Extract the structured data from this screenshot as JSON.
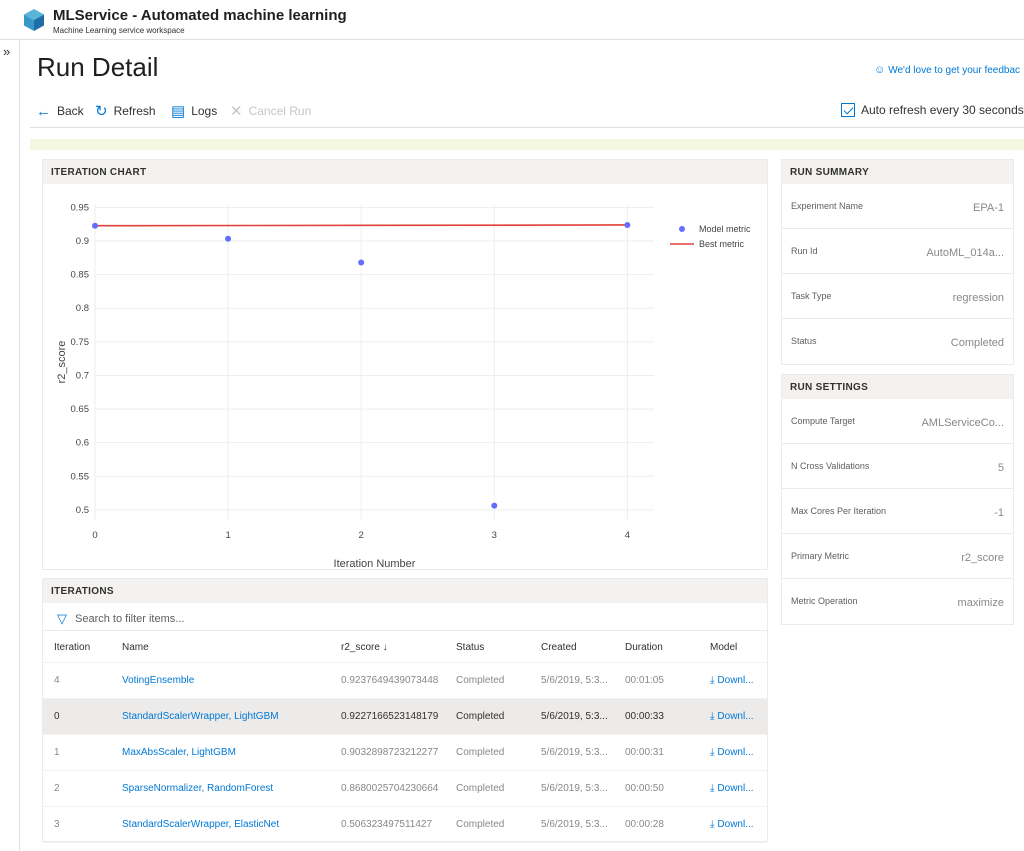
{
  "app": {
    "title": "MLService - Automated machine learning",
    "subtitle": "Machine Learning service workspace"
  },
  "nav": {
    "expand_glyph": "»"
  },
  "page": {
    "title": "Run Detail",
    "feedback": "We'd love to get your feedbac"
  },
  "toolbar": {
    "back": "Back",
    "refresh": "Refresh",
    "logs": "Logs",
    "cancel": "Cancel Run",
    "auto_refresh": "Auto refresh every 30 seconds"
  },
  "chart_section": {
    "title": "ITERATION CHART"
  },
  "chart_data": {
    "type": "scatter",
    "xlabel": "Iteration Number",
    "ylabel": "r2_score",
    "xlim": [
      0,
      4.2
    ],
    "ylim": [
      0.485,
      0.955
    ],
    "xticks": [
      0,
      1,
      2,
      3,
      4
    ],
    "yticks": [
      0.5,
      0.55,
      0.6,
      0.65,
      0.7,
      0.75,
      0.8,
      0.85,
      0.9,
      0.95
    ],
    "series": [
      {
        "name": "Model metric",
        "kind": "points",
        "color": "#636efa",
        "x": [
          0,
          1,
          2,
          3,
          4
        ],
        "y": [
          0.9227,
          0.9033,
          0.868,
          0.5063,
          0.9238
        ]
      },
      {
        "name": "Best metric",
        "kind": "line",
        "color": "#e0403a",
        "x": [
          0,
          4
        ],
        "y": [
          0.9227,
          0.9238
        ]
      }
    ],
    "legend_position": "top-right",
    "grid": true
  },
  "iterations": {
    "title": "ITERATIONS",
    "search_placeholder": "Search to filter items...",
    "columns": [
      "Iteration",
      "Name",
      "r2_score ↓",
      "Status",
      "Created",
      "Duration",
      "Model"
    ],
    "rows": [
      {
        "iteration": "4",
        "name": "VotingEnsemble",
        "score": "0.9237649439073448",
        "status": "Completed",
        "created": "5/6/2019, 5:3...",
        "duration": "00:01:05",
        "model": "Downl..."
      },
      {
        "iteration": "0",
        "name": "StandardScalerWrapper, LightGBM",
        "score": "0.9227166523148179",
        "status": "Completed",
        "created": "5/6/2019, 5:3...",
        "duration": "00:00:33",
        "model": "Downl..."
      },
      {
        "iteration": "1",
        "name": "MaxAbsScaler, LightGBM",
        "score": "0.9032898723212277",
        "status": "Completed",
        "created": "5/6/2019, 5:3...",
        "duration": "00:00:31",
        "model": "Downl..."
      },
      {
        "iteration": "2",
        "name": "SparseNormalizer, RandomForest",
        "score": "0.8680025704230664",
        "status": "Completed",
        "created": "5/6/2019, 5:3...",
        "duration": "00:00:50",
        "model": "Downl..."
      },
      {
        "iteration": "3",
        "name": "StandardScalerWrapper, ElasticNet",
        "score": "0.506323497511427",
        "status": "Completed",
        "created": "5/6/2019, 5:3...",
        "duration": "00:00:28",
        "model": "Downl..."
      }
    ]
  },
  "summary": {
    "title": "RUN SUMMARY",
    "items": [
      {
        "key": "Experiment Name",
        "value": "EPA-1"
      },
      {
        "key": "Run Id",
        "value": "AutoML_014a..."
      },
      {
        "key": "Task Type",
        "value": "regression"
      },
      {
        "key": "Status",
        "value": "Completed"
      }
    ]
  },
  "settings": {
    "title": "RUN SETTINGS",
    "items": [
      {
        "key": "Compute Target",
        "value": "AMLServiceCo..."
      },
      {
        "key": "N Cross Validations",
        "value": "5"
      },
      {
        "key": "Max Cores Per Iteration",
        "value": "-1"
      },
      {
        "key": "Primary Metric",
        "value": "r2_score"
      },
      {
        "key": "Metric Operation",
        "value": "maximize"
      }
    ]
  }
}
